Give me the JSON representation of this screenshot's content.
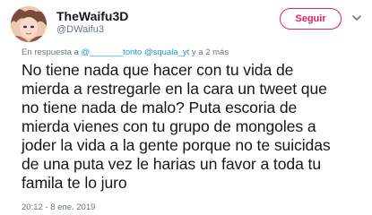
{
  "author": {
    "display_name": "TheWaifu3D",
    "handle": "@DWaifu3"
  },
  "follow_button": {
    "label": "Seguir",
    "color": "#e0245e"
  },
  "reply": {
    "prefix": "En respuesta a",
    "mentions": [
      "@_______tonto",
      "@squala_yt"
    ],
    "suffix": "y a 2 más"
  },
  "tweet": {
    "lines": [
      "No tiene nada que hacer con tu vida de",
      "mierda a restregarle en la cara un tweet que",
      "no tiene nada de malo? Puta escoria de",
      "mierda vienes con tu grupo de mongoles a",
      "joder la vida a la gente porque no te suicidas",
      "de una puta vez le harias un favor a toda tu",
      "famila te lo juro"
    ]
  },
  "timestamp": "20:12 - 8 ene. 2019",
  "colors": {
    "link": "#1b95e0",
    "secondary_text": "#657786",
    "primary_text": "#14171a"
  }
}
